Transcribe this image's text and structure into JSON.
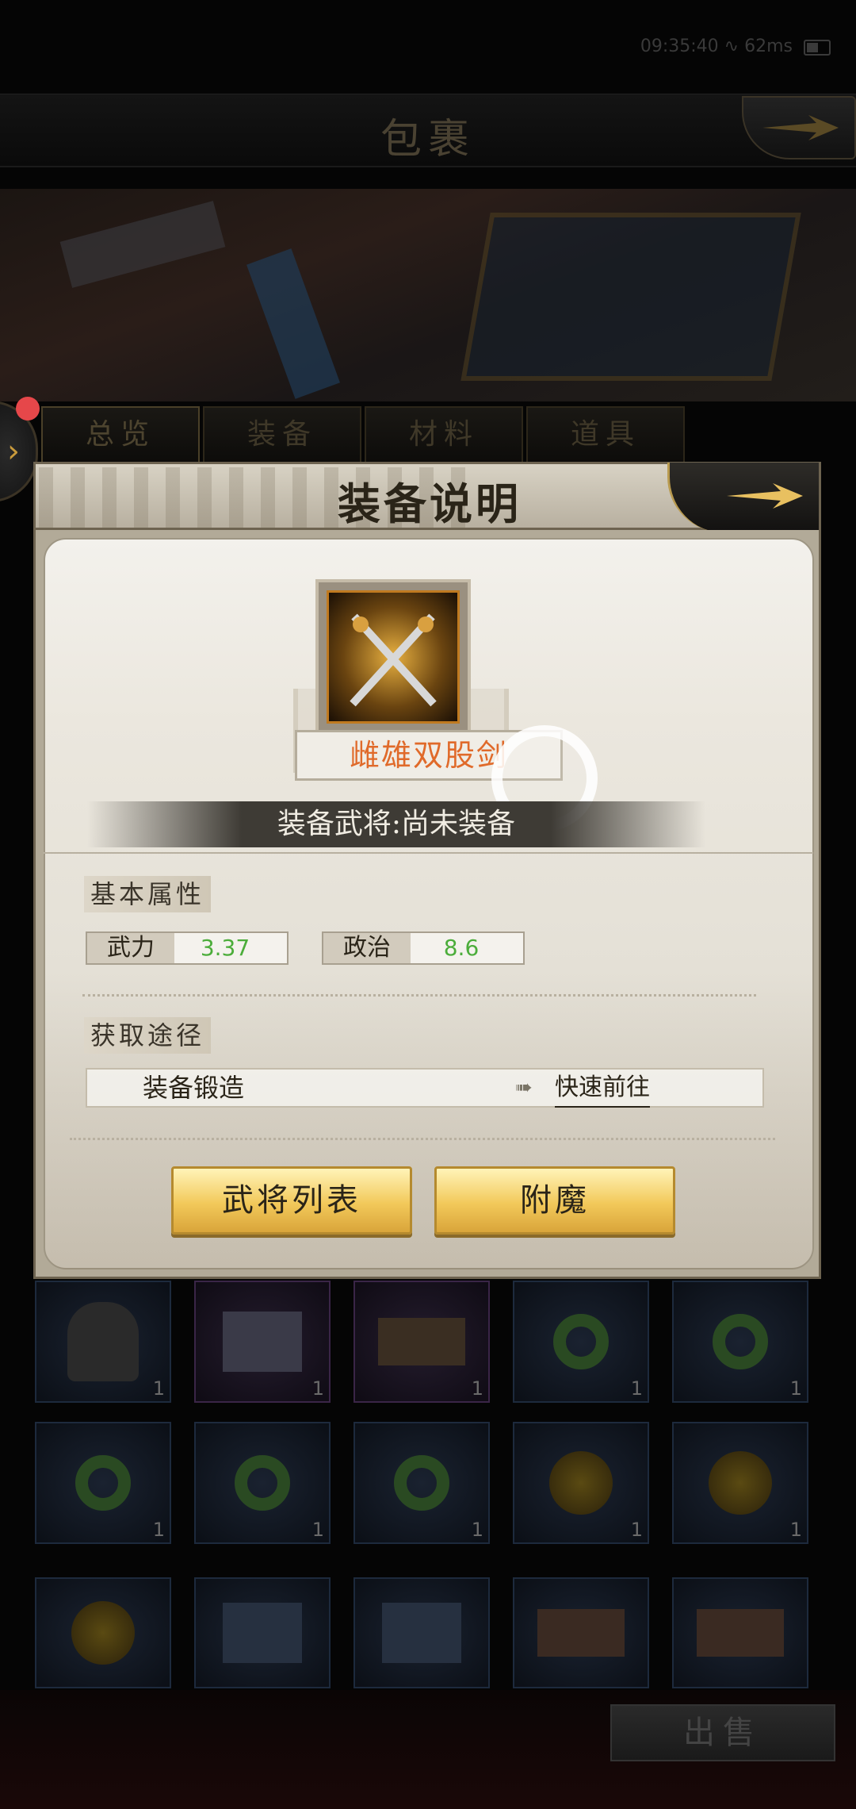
{
  "status": {
    "time": "09:35:40",
    "net": "62ms"
  },
  "header": {
    "title": "包裹"
  },
  "tabs": [
    "总览",
    "装备",
    "材料",
    "道具"
  ],
  "modal": {
    "title": "装备说明",
    "item_name": "雌雄双股剑",
    "equipped_by": "装备武将:尚未装备",
    "basic_attrs_title": "基本属性",
    "attrs": [
      {
        "key": "武力",
        "value": "3.37"
      },
      {
        "key": "政治",
        "value": "8.6"
      }
    ],
    "source_title": "获取途径",
    "source": {
      "label": "装备锻造",
      "goto": "快速前往"
    },
    "buttons": {
      "generals": "武将列表",
      "enchant": "附魔"
    }
  },
  "inventory_counts": [
    "1",
    "1",
    "1",
    "1",
    "1",
    "1",
    "1",
    "1",
    "1",
    "1"
  ],
  "footer": {
    "sell": "出售"
  }
}
